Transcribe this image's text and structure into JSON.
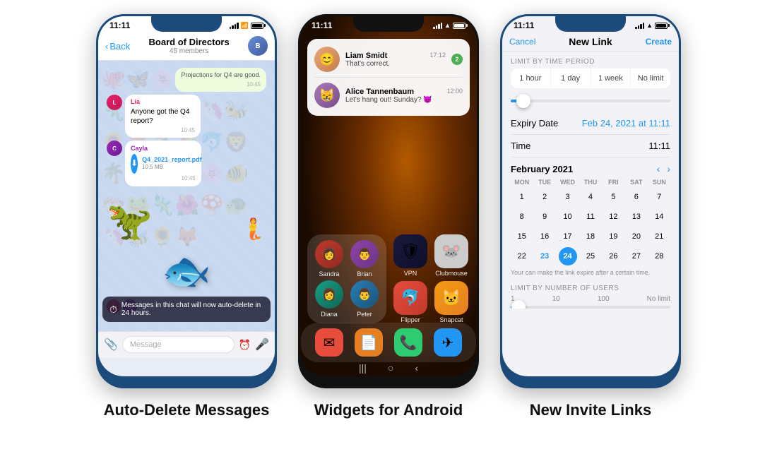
{
  "phones": [
    {
      "id": "phone1",
      "label": "Auto-Delete Messages",
      "statusTime": "11:11",
      "chat": {
        "backLabel": "Back",
        "title": "Board of Directors",
        "subtitle": "45 members",
        "messages": [
          {
            "type": "incoming",
            "sender": "Lia",
            "senderColor": "#e91e63",
            "text": "Anyone got the Q4 report?",
            "time": "10:45"
          },
          {
            "type": "file",
            "sender": "Cayla",
            "senderColor": "#9c27b0",
            "filename": "Q4_2021_report.pdf",
            "size": "10.5 MB",
            "time": "10:45"
          }
        ],
        "autoBannerText": "Messages in this chat will now auto-delete in 24 hours.",
        "inputPlaceholder": "Message"
      }
    },
    {
      "id": "phone2",
      "label": "Widgets for Android",
      "statusTime": "11:11",
      "notifications": [
        {
          "name": "Liam Smidt",
          "msg": "That's correct.",
          "time": "17:12",
          "badge": "2"
        },
        {
          "name": "Alice Tannenbaum",
          "msg": "Let's hang out! Sunday? 😈",
          "time": "12:00",
          "badge": null
        }
      ],
      "folderPeople": [
        {
          "name": "Sandra"
        },
        {
          "name": "Brian"
        },
        {
          "name": "Diana"
        },
        {
          "name": "Peter"
        }
      ],
      "apps": [
        {
          "name": "VPN",
          "icon": "🛡"
        },
        {
          "name": "Clubmouse",
          "icon": "🐭"
        },
        {
          "name": "Flipper",
          "icon": "🐬"
        },
        {
          "name": "Snapcat",
          "icon": "🐱"
        }
      ],
      "dockApps": [
        "✉",
        "📄",
        "📞",
        "✈"
      ],
      "navButtons": [
        "|||",
        "○",
        "<"
      ]
    },
    {
      "id": "phone3",
      "label": "New Invite Links",
      "statusTime": "11:11",
      "invite": {
        "cancelLabel": "Cancel",
        "title": "New Link",
        "createLabel": "Create",
        "limitByTimePeriodLabel": "LIMIT BY TIME PERIOD",
        "timeOptions": [
          "1 hour",
          "1 day",
          "1 week",
          "No limit"
        ],
        "expiryDateLabel": "Expiry Date",
        "expiryDateValue": "Feb 24, 2021 at 11:11",
        "timeLabel": "Time",
        "timeValue": "11:11",
        "calendarMonth": "February 2021",
        "dayHeaders": [
          "MON",
          "TUE",
          "WED",
          "THU",
          "FRI",
          "SAT",
          "SUN"
        ],
        "calendarRows": [
          [
            {
              "n": "1"
            },
            {
              "n": "2"
            },
            {
              "n": "3"
            },
            {
              "n": "4"
            },
            {
              "n": "5"
            },
            {
              "n": "6"
            },
            {
              "n": "7"
            }
          ],
          [
            {
              "n": "8"
            },
            {
              "n": "9"
            },
            {
              "n": "10"
            },
            {
              "n": "11"
            },
            {
              "n": "12"
            },
            {
              "n": "13"
            },
            {
              "n": "14"
            }
          ],
          [
            {
              "n": "15"
            },
            {
              "n": "16"
            },
            {
              "n": "17"
            },
            {
              "n": "18"
            },
            {
              "n": "19"
            },
            {
              "n": "20"
            },
            {
              "n": "21"
            }
          ],
          [
            {
              "n": "22"
            },
            {
              "n": "23",
              "sel": true
            },
            {
              "n": "24",
              "today": true
            },
            {
              "n": "25"
            },
            {
              "n": "26"
            },
            {
              "n": "27"
            },
            {
              "n": "28"
            }
          ]
        ],
        "expireNote": "Your can make the link expire after a certain time.",
        "limitByUsersLabel": "LIMIT BY NUMBER OF USERS",
        "userLabels": [
          "1",
          "10",
          "100",
          "No limit"
        ]
      }
    }
  ]
}
